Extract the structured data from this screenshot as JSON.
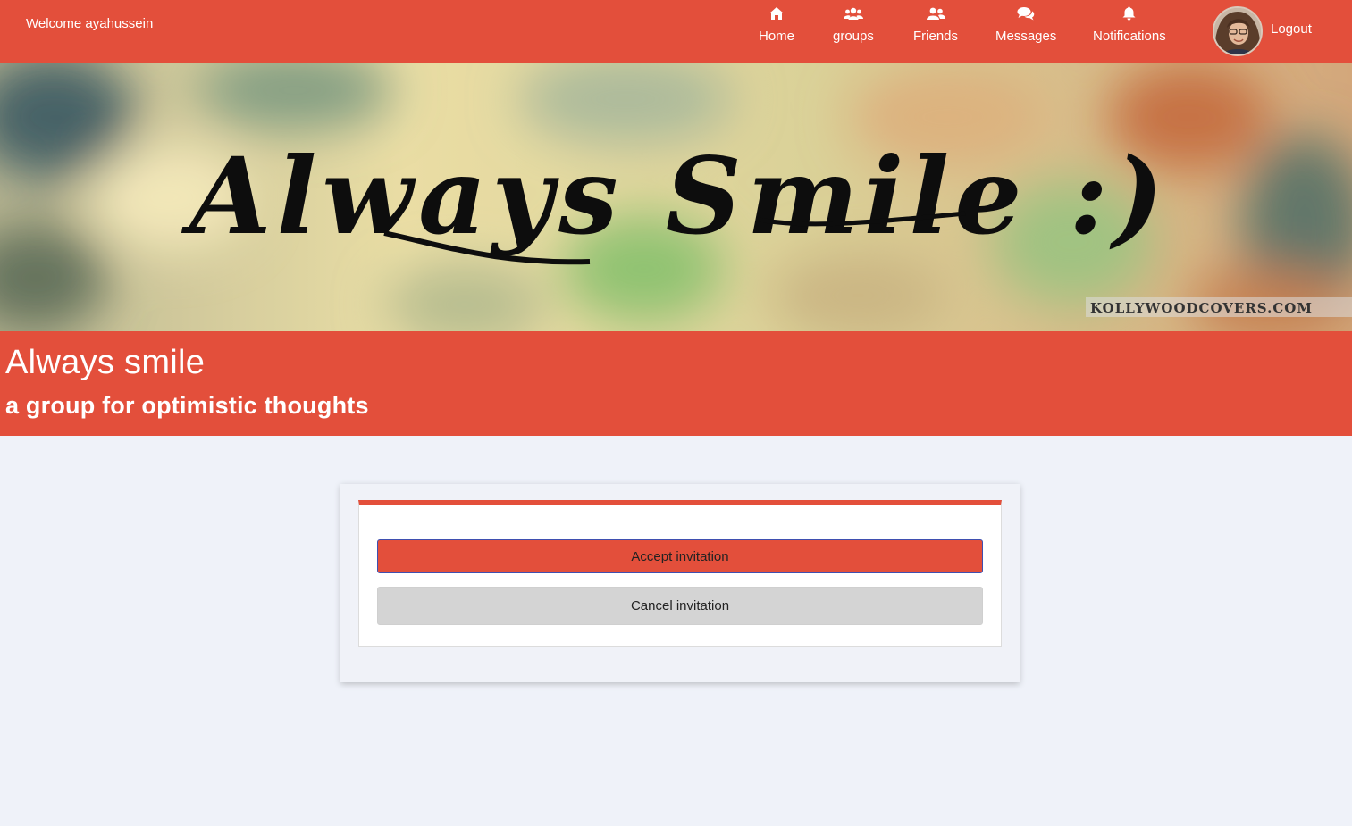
{
  "navbar": {
    "welcome": "Welcome ayahussein",
    "items": [
      {
        "label": "Home",
        "icon": "home-icon"
      },
      {
        "label": "groups",
        "icon": "users-icon"
      },
      {
        "label": "Friends",
        "icon": "user-friends-icon"
      },
      {
        "label": "Messages",
        "icon": "comments-icon"
      },
      {
        "label": "Notifications",
        "icon": "bell-icon"
      }
    ],
    "logout": "Logout",
    "background_color": "#e34f3b"
  },
  "banner": {
    "text": "Always Smile :)",
    "watermark": "KOLLYWOODCOVERS.COM"
  },
  "group": {
    "title": "Always smile",
    "description": "a group for optimistic thoughts"
  },
  "invitation": {
    "accept_label": "Accept invitation",
    "cancel_label": "Cancel invitation"
  }
}
